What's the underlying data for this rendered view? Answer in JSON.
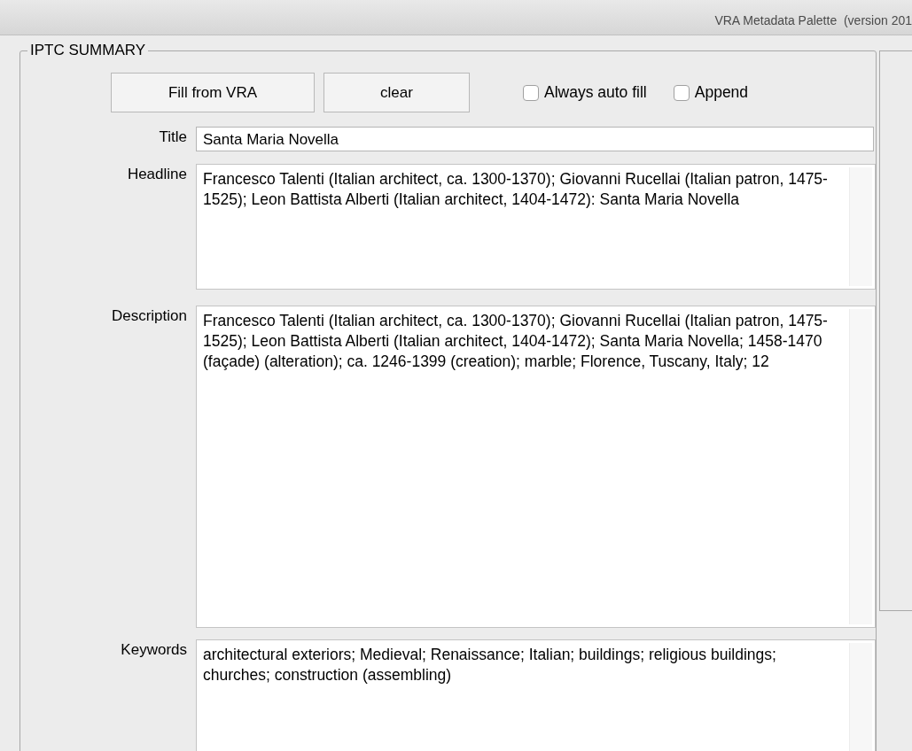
{
  "window": {
    "title": "VRA Metadata Palette  (version 201"
  },
  "group": {
    "title": "IPTC SUMMARY"
  },
  "buttons": [
    "Fill from VRA",
    "clear"
  ],
  "options": [
    {
      "label": "Always auto fill",
      "checked": false
    },
    {
      "label": "Append",
      "checked": false
    }
  ],
  "fields": [
    {
      "label": "Title",
      "kind": "line",
      "value": "Santa Maria Novella"
    },
    {
      "label": "Headline",
      "kind": "area",
      "value": "Francesco Talenti (Italian architect, ca. 1300-1370); Giovanni Rucellai (Italian patron, 1475-1525); Leon Battista Alberti (Italian architect, 1404-1472): Santa Maria Novella"
    },
    {
      "label": "Description",
      "kind": "area",
      "value": "Francesco Talenti (Italian architect, ca. 1300-1370); Giovanni Rucellai (Italian patron, 1475-1525); Leon Battista Alberti (Italian architect, 1404-1472); Santa Maria Novella; 1458-1470 (façade) (alteration); ca. 1246-1399 (creation); marble; Florence, Tuscany, Italy; 12"
    },
    {
      "label": "Keywords",
      "kind": "area",
      "value": "architectural exteriors; Medieval; Renaissance; Italian; buildings; religious buildings; churches; construction (assembling)"
    }
  ]
}
